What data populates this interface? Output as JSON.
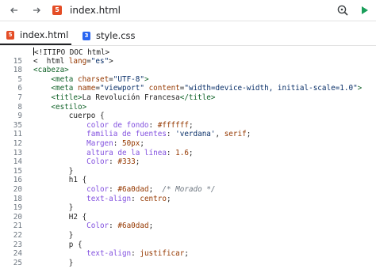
{
  "topbar": {
    "file_title": "index.html",
    "html_badge": "5",
    "back_icon": "arrow-left-icon",
    "forward_icon": "arrow-right-icon",
    "search_icon": "search-icon",
    "run_icon": "play-icon",
    "run_color": "#1a9e5a"
  },
  "tabs": [
    {
      "label": "index.html",
      "icon": "html-file-icon",
      "badge": "5",
      "active": true
    },
    {
      "label": "style.css",
      "icon": "css-file-icon",
      "badge": "3",
      "active": false
    }
  ],
  "editor": {
    "lines": [
      {
        "num": "",
        "tokens": [
          {
            "t": "<!ITIPO DOC html>",
            "c": "plain"
          }
        ]
      },
      {
        "num": "15",
        "tokens": [
          {
            "t": "<  html ",
            "c": "plain"
          },
          {
            "t": "lang",
            "c": "attr"
          },
          {
            "t": "=",
            "c": "plain"
          },
          {
            "t": "\"es\"",
            "c": "str"
          },
          {
            "t": ">",
            "c": "plain"
          }
        ]
      },
      {
        "num": "18",
        "tokens": [
          {
            "t": "<cabeza>",
            "c": "tag"
          }
        ]
      },
      {
        "num": "5",
        "tokens": [
          {
            "t": "    <meta ",
            "c": "tag"
          },
          {
            "t": "charset",
            "c": "attr"
          },
          {
            "t": "=",
            "c": "plain"
          },
          {
            "t": "\"UTF-8\"",
            "c": "str"
          },
          {
            "t": ">",
            "c": "tag"
          }
        ]
      },
      {
        "num": "6",
        "tokens": [
          {
            "t": "    <meta ",
            "c": "tag"
          },
          {
            "t": "name",
            "c": "attr"
          },
          {
            "t": "=",
            "c": "plain"
          },
          {
            "t": "\"viewport\"",
            "c": "str"
          },
          {
            "t": " ",
            "c": "plain"
          },
          {
            "t": "content",
            "c": "attr"
          },
          {
            "t": "=",
            "c": "plain"
          },
          {
            "t": "\"width=device-width, initial-scale=1.0\"",
            "c": "str"
          },
          {
            "t": ">",
            "c": "tag"
          }
        ]
      },
      {
        "num": "7",
        "tokens": [
          {
            "t": "    <title>",
            "c": "tag"
          },
          {
            "t": "La Revolución Francesa",
            "c": "plain"
          },
          {
            "t": "</title>",
            "c": "tag"
          }
        ]
      },
      {
        "num": "8",
        "tokens": [
          {
            "t": "    <estilo>",
            "c": "tag"
          }
        ]
      },
      {
        "num": "9",
        "tokens": [
          {
            "t": "        cuerpo {",
            "c": "plain"
          }
        ]
      },
      {
        "num": "35",
        "tokens": [
          {
            "t": "            ",
            "c": "plain"
          },
          {
            "t": "color de fondo",
            "c": "prop"
          },
          {
            "t": ": ",
            "c": "plain"
          },
          {
            "t": "#ffffff",
            "c": "val"
          },
          {
            "t": ";",
            "c": "plain"
          }
        ]
      },
      {
        "num": "11",
        "tokens": [
          {
            "t": "            ",
            "c": "plain"
          },
          {
            "t": "familia de fuentes",
            "c": "prop"
          },
          {
            "t": ": ",
            "c": "plain"
          },
          {
            "t": "'verdana'",
            "c": "str"
          },
          {
            "t": ", ",
            "c": "plain"
          },
          {
            "t": "serif",
            "c": "val"
          },
          {
            "t": ";",
            "c": "plain"
          }
        ]
      },
      {
        "num": "12",
        "tokens": [
          {
            "t": "            ",
            "c": "plain"
          },
          {
            "t": "Margen",
            "c": "prop"
          },
          {
            "t": ": ",
            "c": "plain"
          },
          {
            "t": "50px",
            "c": "num"
          },
          {
            "t": ";",
            "c": "plain"
          }
        ]
      },
      {
        "num": "13",
        "tokens": [
          {
            "t": "            ",
            "c": "plain"
          },
          {
            "t": "altura de la línea",
            "c": "prop"
          },
          {
            "t": ": ",
            "c": "plain"
          },
          {
            "t": "1.6",
            "c": "num"
          },
          {
            "t": ";",
            "c": "plain"
          }
        ]
      },
      {
        "num": "14",
        "tokens": [
          {
            "t": "            ",
            "c": "plain"
          },
          {
            "t": "Color",
            "c": "prop"
          },
          {
            "t": ": ",
            "c": "plain"
          },
          {
            "t": "#333",
            "c": "val"
          },
          {
            "t": ";",
            "c": "plain"
          }
        ]
      },
      {
        "num": "15",
        "tokens": [
          {
            "t": "        }",
            "c": "plain"
          }
        ]
      },
      {
        "num": "16",
        "tokens": [
          {
            "t": "        h1 {",
            "c": "plain"
          }
        ]
      },
      {
        "num": "20",
        "tokens": [
          {
            "t": "            ",
            "c": "plain"
          },
          {
            "t": "color",
            "c": "prop"
          },
          {
            "t": ": ",
            "c": "plain"
          },
          {
            "t": "#6a0dad",
            "c": "val"
          },
          {
            "t": ";  ",
            "c": "plain"
          },
          {
            "t": "/* Morado */",
            "c": "com"
          }
        ]
      },
      {
        "num": "18",
        "tokens": [
          {
            "t": "            ",
            "c": "plain"
          },
          {
            "t": "text-align",
            "c": "prop"
          },
          {
            "t": ": ",
            "c": "plain"
          },
          {
            "t": "centro",
            "c": "val"
          },
          {
            "t": ";",
            "c": "plain"
          }
        ]
      },
      {
        "num": "19",
        "tokens": [
          {
            "t": "        }",
            "c": "plain"
          }
        ]
      },
      {
        "num": "20",
        "tokens": [
          {
            "t": "        H2 {",
            "c": "plain"
          }
        ]
      },
      {
        "num": "21",
        "tokens": [
          {
            "t": "            ",
            "c": "plain"
          },
          {
            "t": "Color",
            "c": "prop"
          },
          {
            "t": ": ",
            "c": "plain"
          },
          {
            "t": "#6a0dad",
            "c": "val"
          },
          {
            "t": ";",
            "c": "plain"
          }
        ]
      },
      {
        "num": "22",
        "tokens": [
          {
            "t": "        }",
            "c": "plain"
          }
        ]
      },
      {
        "num": "23",
        "tokens": [
          {
            "t": "        p {",
            "c": "plain"
          }
        ]
      },
      {
        "num": "24",
        "tokens": [
          {
            "t": "            ",
            "c": "plain"
          },
          {
            "t": "text-align",
            "c": "prop"
          },
          {
            "t": ": ",
            "c": "plain"
          },
          {
            "t": "justificar",
            "c": "val"
          },
          {
            "t": ";",
            "c": "plain"
          }
        ]
      },
      {
        "num": "25",
        "tokens": [
          {
            "t": "        }",
            "c": "plain"
          }
        ]
      }
    ]
  }
}
